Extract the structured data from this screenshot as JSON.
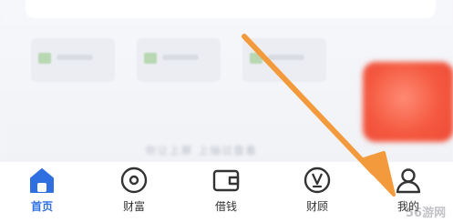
{
  "tabbar": {
    "items": [
      {
        "label": "首页",
        "icon": "home-icon",
        "active": true
      },
      {
        "label": "财富",
        "icon": "wealth-coin-icon",
        "active": false
      },
      {
        "label": "借钱",
        "icon": "wallet-icon",
        "active": false
      },
      {
        "label": "财顾",
        "icon": "advisor-icon",
        "active": false
      },
      {
        "label": "我的",
        "icon": "profile-icon",
        "active": false
      }
    ]
  },
  "faint_text": "你让上屏 上抽过盘着",
  "watermark": "56游网",
  "colors": {
    "accent": "#2f6fe0",
    "arrow": "#f39a3c",
    "promo": "#f4583f"
  }
}
